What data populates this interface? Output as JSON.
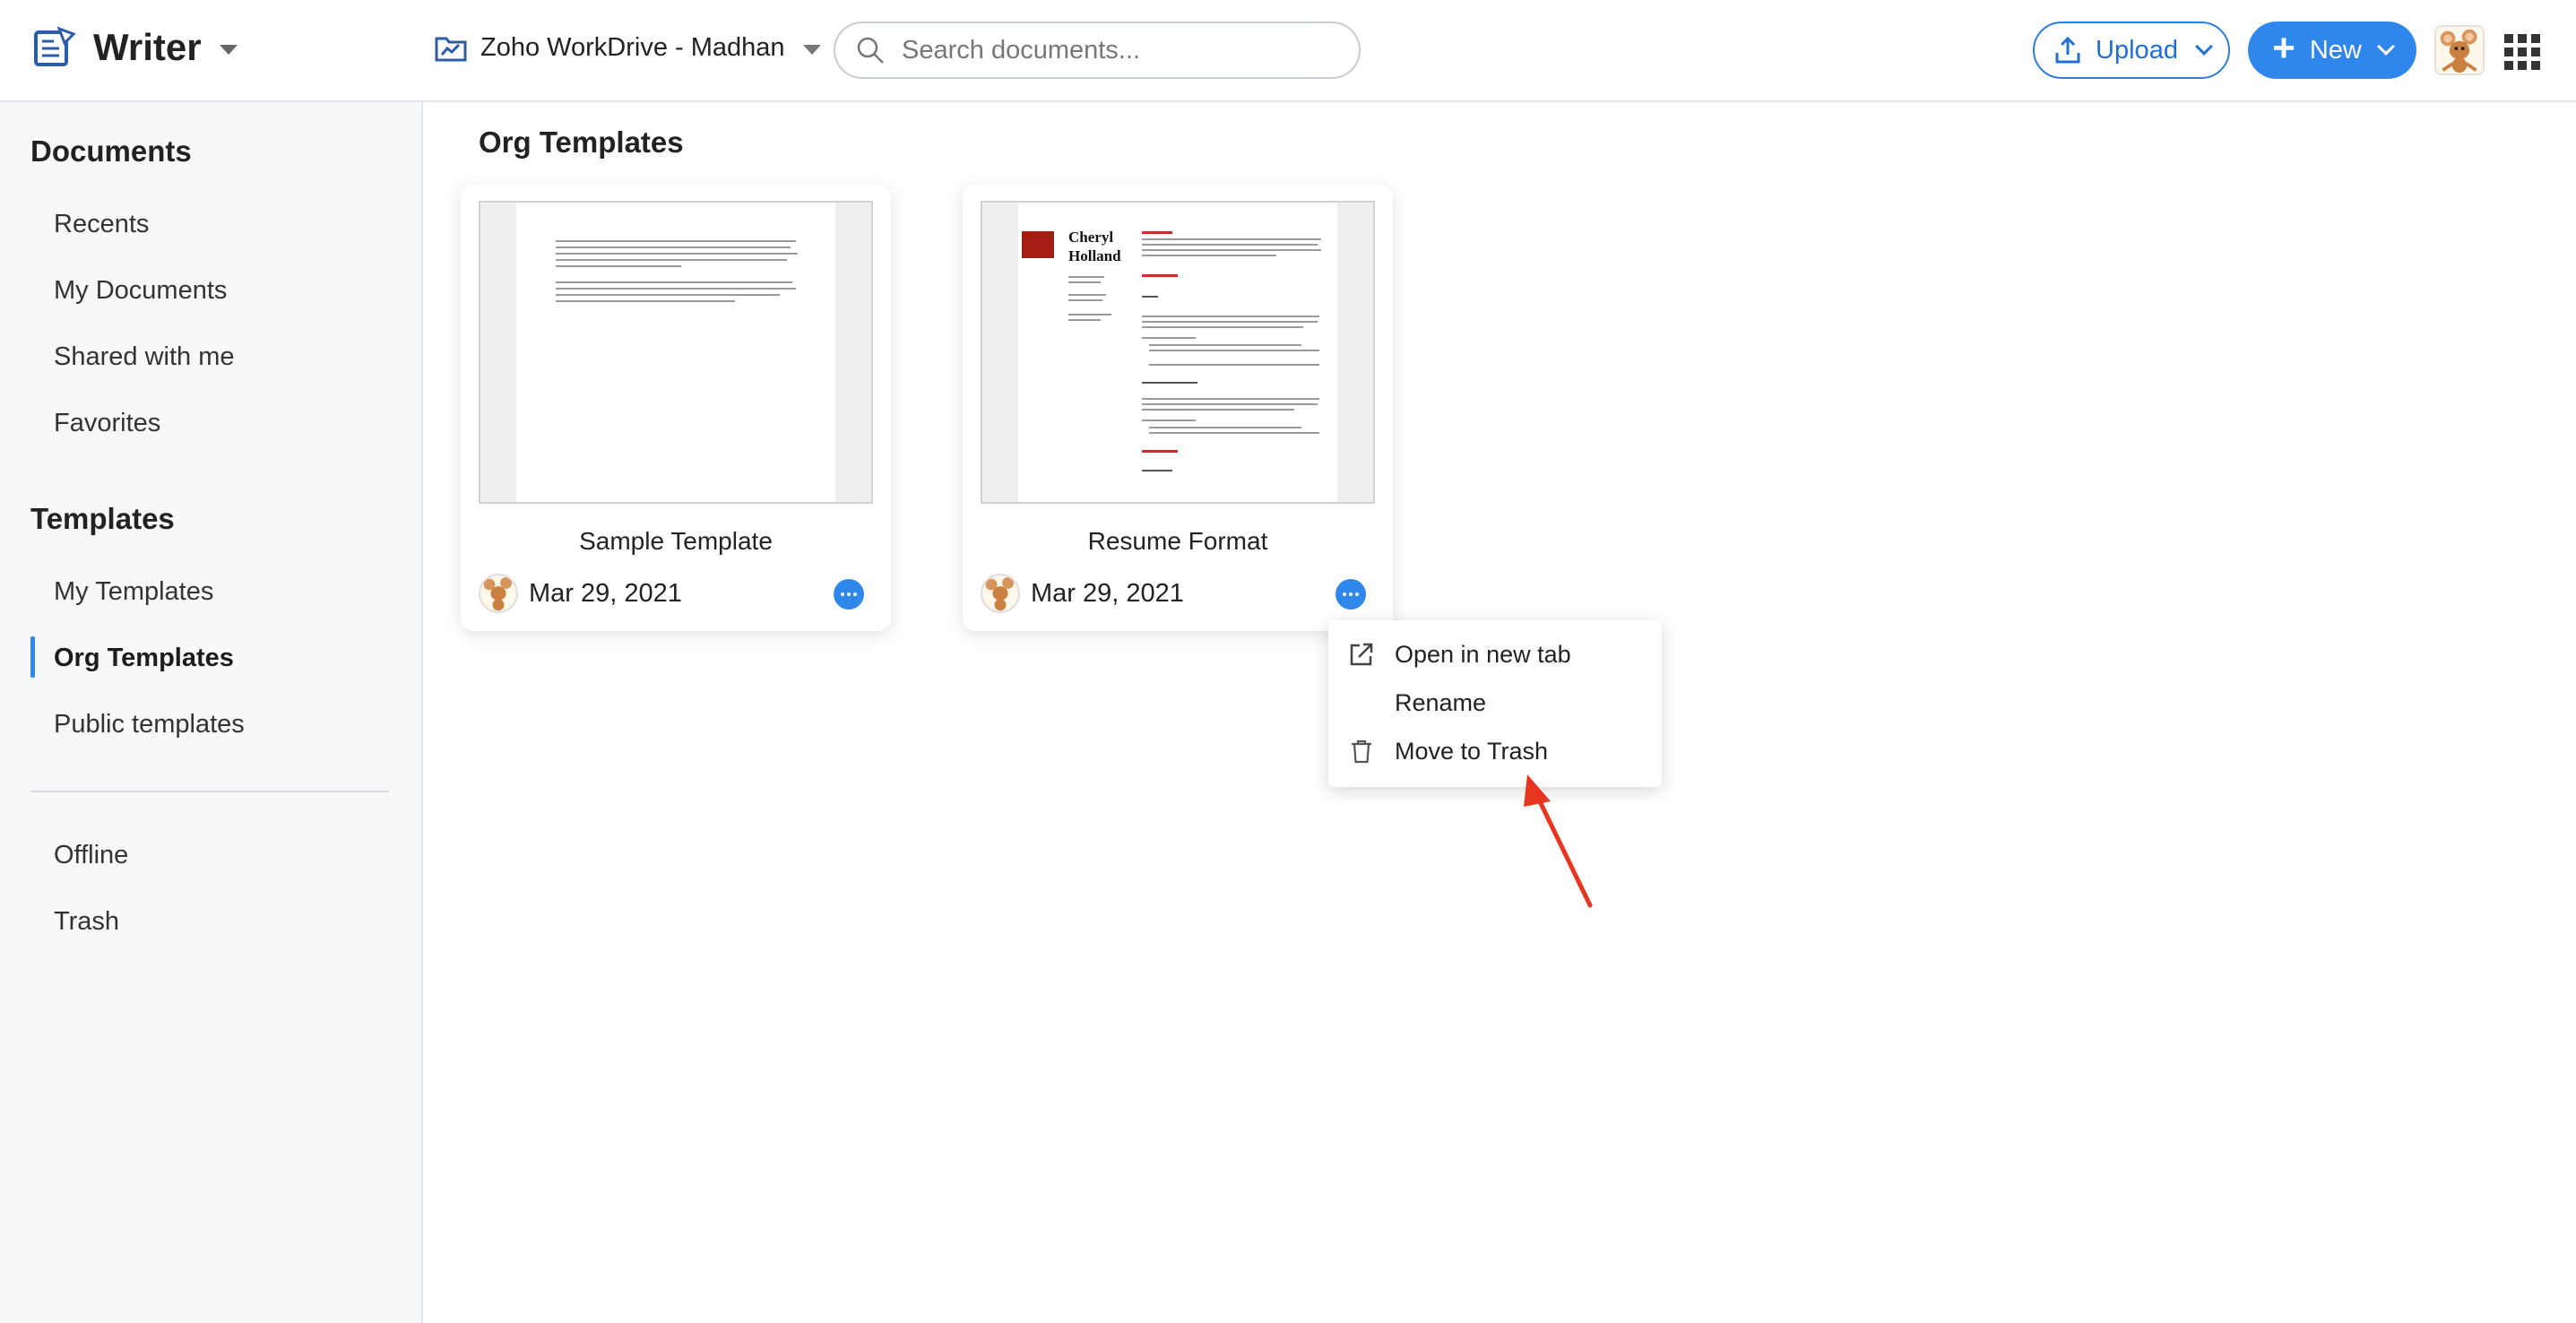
{
  "header": {
    "app_name": "Writer",
    "workspace": "Zoho WorkDrive - Madhan",
    "search_placeholder": "Search documents...",
    "upload_label": "Upload",
    "new_label": "New"
  },
  "sidebar": {
    "documents_title": "Documents",
    "documents_items": [
      "Recents",
      "My Documents",
      "Shared with me",
      "Favorites"
    ],
    "templates_title": "Templates",
    "templates_items": [
      "My Templates",
      "Org Templates",
      "Public templates"
    ],
    "active_item": "Org Templates",
    "other_items": [
      "Offline",
      "Trash"
    ]
  },
  "main": {
    "title": "Org Templates",
    "cards": [
      {
        "title": "Sample Template",
        "date": "Mar 29, 2021"
      },
      {
        "title": "Resume Format",
        "date": "Mar 29, 2021",
        "resume_name_line1": "Cheryl",
        "resume_name_line2": "Holland"
      }
    ]
  },
  "context_menu": {
    "items": [
      "Open in new tab",
      "Rename",
      "Move to Trash"
    ]
  },
  "colors": {
    "accent": "#2f86eb",
    "annotation_arrow": "#e8351f",
    "resume_accent": "#a61b12"
  }
}
